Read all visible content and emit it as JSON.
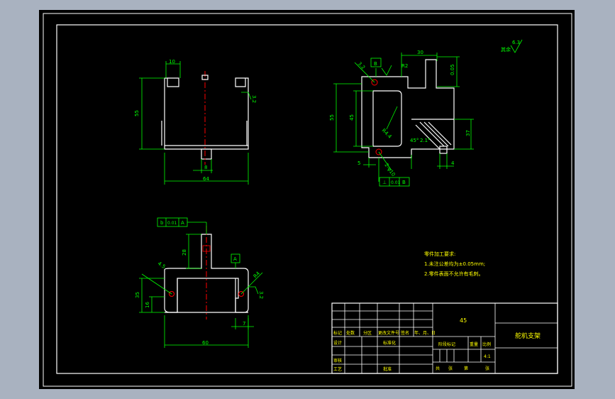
{
  "colors": {
    "background": "#000000",
    "frame": "#ffffff",
    "dimension": "#00ff00",
    "centerline": "#ff0000",
    "outline": "#ffffff",
    "label": "#ffff00",
    "outer_bg": "#a9b2c0"
  },
  "view_front": {
    "dim_top": "10",
    "dim_height": "55",
    "dim_width": "64",
    "dim_center": "8",
    "roughness": "3.2"
  },
  "view_side": {
    "datum_top": "B",
    "dim_top_width": "30",
    "dim_top_tol": "0.05",
    "dim_height": "55",
    "dim_inner": "45",
    "dim_right": "37",
    "dim_bottom": "5",
    "dim_r": "4",
    "radius_label": "R2",
    "chamfer": "R4.4",
    "angle_1": "45°",
    "angle_2": "2.1°",
    "hole_label": "2-φ10",
    "roughness": "3.2",
    "tolerance_frame": [
      "⊥",
      "0.01",
      "B"
    ]
  },
  "view_top": {
    "tolerance_frame": [
      "b",
      "0.01",
      "A"
    ],
    "datum": "A",
    "dim_height": "35",
    "dim_lower": "16",
    "dim_width": "60",
    "dim_hole": "4.5",
    "dim_r": "R4",
    "dim_stub": "28",
    "dim_small": "7",
    "roughness": "3.2"
  },
  "surface_note": "其余",
  "surface_value": "6.3",
  "tech_notes": {
    "title": "零件加工要求:",
    "lines": [
      "1.未注公差均为±0.05mm;",
      "2.零件表面不允许有毛刺。"
    ]
  },
  "title_block": {
    "material": "45",
    "part_name": "舵机支架",
    "row_headers": [
      "标记",
      "处数",
      "分区",
      "更改文件号",
      "签名",
      "年、月、日"
    ],
    "design": "设计",
    "standardize": "标准化",
    "review": "审核",
    "process": "工艺",
    "approve": "批准",
    "stage_label": "阶段标记",
    "weight": "重量",
    "scale": "比例",
    "scale_value": "4:1",
    "sheet_total": "共",
    "sheet_unit": "张",
    "sheet_no": "第",
    "sheet_unit2": "张"
  }
}
